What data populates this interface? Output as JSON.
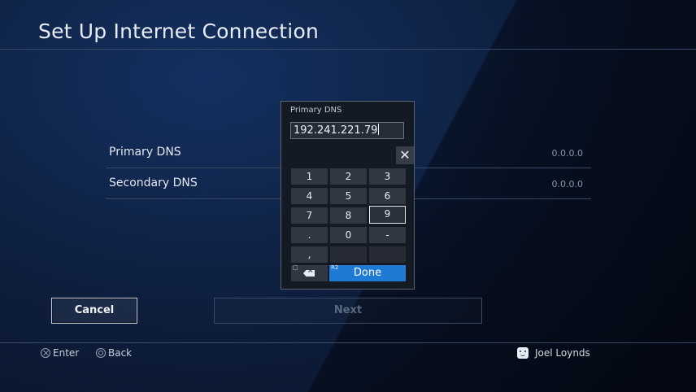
{
  "header": {
    "title": "Set Up Internet Connection"
  },
  "settings": {
    "rows": [
      {
        "label": "Primary DNS",
        "value": "0.0.0.0"
      },
      {
        "label": "Secondary DNS",
        "value": "0.0.0.0"
      }
    ]
  },
  "buttons": {
    "cancel": "Cancel",
    "next": "Next"
  },
  "footer": {
    "enter_label": "Enter",
    "back_label": "Back",
    "user_name": "Joel Loynds"
  },
  "keypad": {
    "label": "Primary DNS",
    "input_value": "192.241.221.79",
    "close_glyph": "✕",
    "keys": [
      "1",
      "2",
      "3",
      "4",
      "5",
      "6",
      "7",
      "8",
      "9",
      ".",
      "0",
      "-",
      ",",
      "",
      ""
    ],
    "selected_key": "9",
    "backspace_tag": "□",
    "done_tag": "R2",
    "done_label": "Done"
  },
  "colors": {
    "accent": "#1e7ad2",
    "background": "#0c1830"
  }
}
